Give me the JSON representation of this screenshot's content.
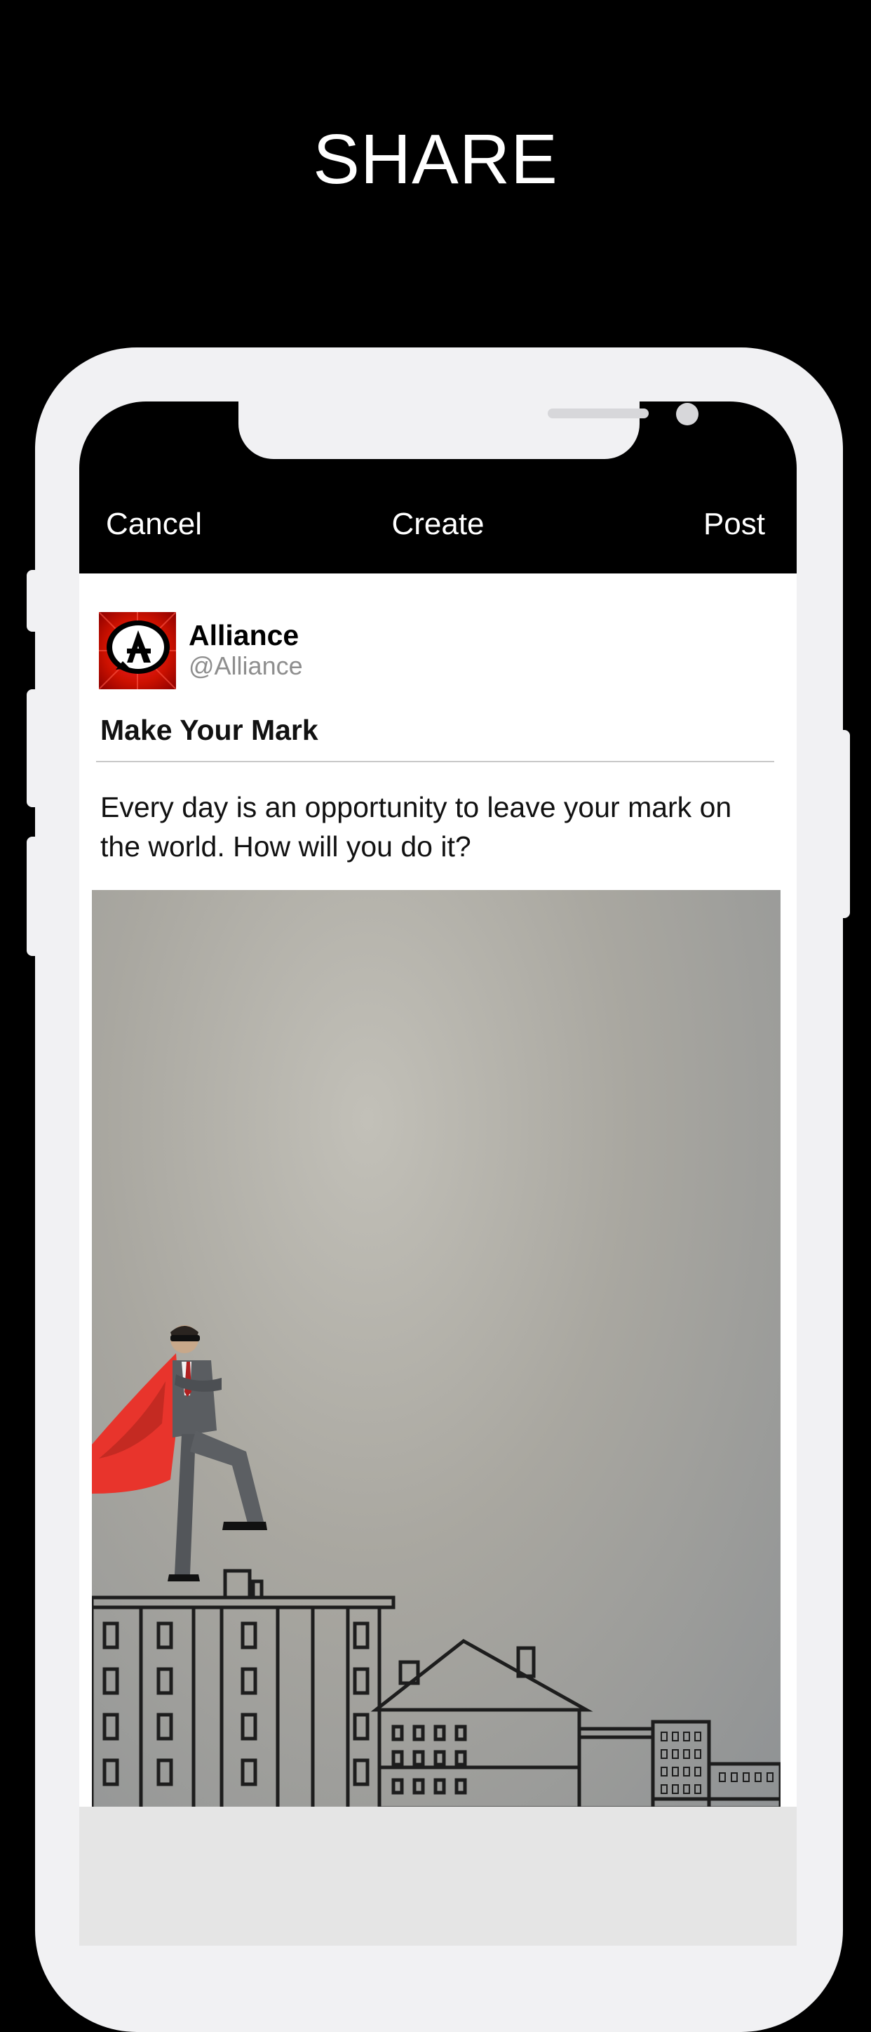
{
  "headline": "SHARE",
  "nav": {
    "cancel": "Cancel",
    "title": "Create",
    "post": "Post"
  },
  "account": {
    "name": "Alliance",
    "handle": "@Alliance",
    "avatar_icon": "alliance-logo-icon",
    "avatar_letter": "A"
  },
  "post": {
    "title": "Make Your Mark",
    "body": "Every day is an opportunity to leave your mark on the world. How will you do it?",
    "image_icon": "superhero-businessman-on-rooftop-image"
  },
  "colors": {
    "background": "#000000",
    "frame": "#f1f1f3",
    "brand_red": "#d4101a",
    "cape": "#e8342c"
  }
}
